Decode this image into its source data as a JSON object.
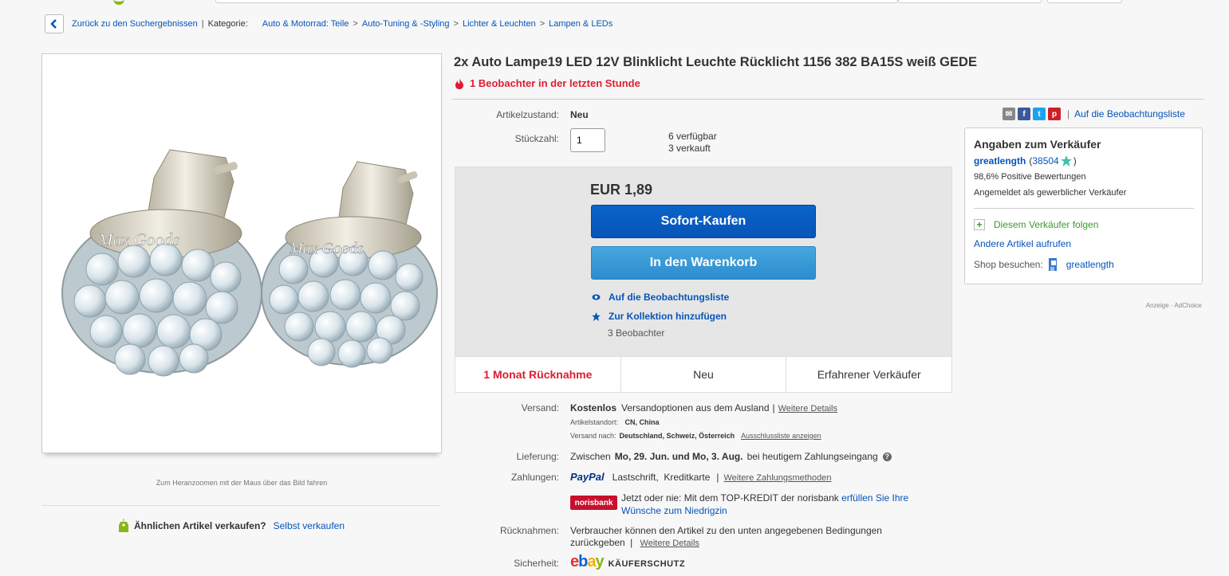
{
  "breadcrumb": {
    "back": "Zurück zu den Suchergebnissen",
    "category_label": "Kategorie:",
    "items": [
      "Auto & Motorrad: Teile",
      "Auto-Tuning & -Styling",
      "Lichter & Leuchten",
      "Lampen & LEDs"
    ],
    "separator": ">",
    "pipe": "|"
  },
  "product": {
    "title": "2x Auto Lampe19 LED 12V Blinklicht Leuchte Rücklicht 1156 382 BA15S weiß GEDE",
    "watchers_hot": "1 Beobachter in der letzten Stunde",
    "image_watermark": "Max Goods",
    "zoom_hint": "Zum Heranzoomen mit der Maus über das Bild fahren"
  },
  "sell_similar": {
    "question": "Ähnlichen Artikel verkaufen?",
    "link": "Selbst verkaufen"
  },
  "condition": {
    "label": "Artikelzustand:",
    "value": "Neu"
  },
  "quantity": {
    "label": "Stückzahl:",
    "value": "1",
    "available": "6 verfügbar",
    "sold": "3 verkauft"
  },
  "share": {
    "watchlist_link": "Auf die Beobachtungsliste",
    "pipe": "|"
  },
  "buy": {
    "price": "EUR 1,89",
    "buy_now": "Sofort-Kaufen",
    "add_to_cart": "In den Warenkorb",
    "watch_link": "Auf die Beobachtungsliste",
    "collection_link": "Zur Kollektion hinzufügen",
    "watchers": "3 Beobachter",
    "features": [
      "1 Monat Rücknahme",
      "Neu",
      "Erfahrener Verkäufer"
    ]
  },
  "seller": {
    "heading": "Angaben zum Verkäufer",
    "name": "greatlength",
    "feedback_open": "(",
    "feedback_count": "38504",
    "feedback_close": ")",
    "positive": "98,6% Positive Bewertungen",
    "type": "Angemeldet als gewerblicher Verkäufer",
    "follow": "Diesem Verkäufer folgen",
    "other_items": "Andere Artikel aufrufen",
    "shop_label": "Shop besuchen:",
    "shop_name": "greatlength"
  },
  "ad": {
    "label": "Anzeige - AdChoice"
  },
  "shipping": {
    "label": "Versand:",
    "cost": "Kostenlos",
    "desc": "Versandoptionen aus dem Ausland",
    "pipe": "|",
    "details": "Weitere Details",
    "location_label": "Artikelstandort:",
    "location": "CN, China",
    "to_label": "Versand nach:",
    "to": "Deutschland, Schweiz, Österreich",
    "exclusions": "Ausschlussliste anzeigen"
  },
  "delivery": {
    "label": "Lieferung:",
    "pre": "Zwischen",
    "range": "Mo, 29. Jun. und Mo, 3. Aug.",
    "post": "bei heutigem Zahlungseingang"
  },
  "payment": {
    "label": "Zahlungen:",
    "paypal": "PayPal",
    "methods": "Lastschrift,  Kreditkarte",
    "pipe": "|",
    "more": "Weitere Zahlungsmethoden",
    "norisbank_logo": "norisbank",
    "norisbank_text": "Jetzt oder nie: Mit dem TOP-KREDIT der norisbank",
    "norisbank_link1": "erfüllen Sie Ihre",
    "norisbank_link2": "Wünsche zum Niedrigzin"
  },
  "returns": {
    "label": "Rücknahmen:",
    "line1": "Verbraucher können den Artikel zu den unten angegebenen Bedingungen",
    "line2": "zurückgeben",
    "pipe": "|",
    "details": "Weitere Details"
  },
  "security": {
    "label": "Sicherheit:",
    "logo_e": "e",
    "logo_b": "b",
    "logo_a": "a",
    "logo_y": "y",
    "text": "KÄUFERSCHUTZ"
  },
  "colors": {
    "link": "#0654ba",
    "hot": "#dd1e31",
    "buy": "#0654ba",
    "cart": "#3a9ad9"
  }
}
